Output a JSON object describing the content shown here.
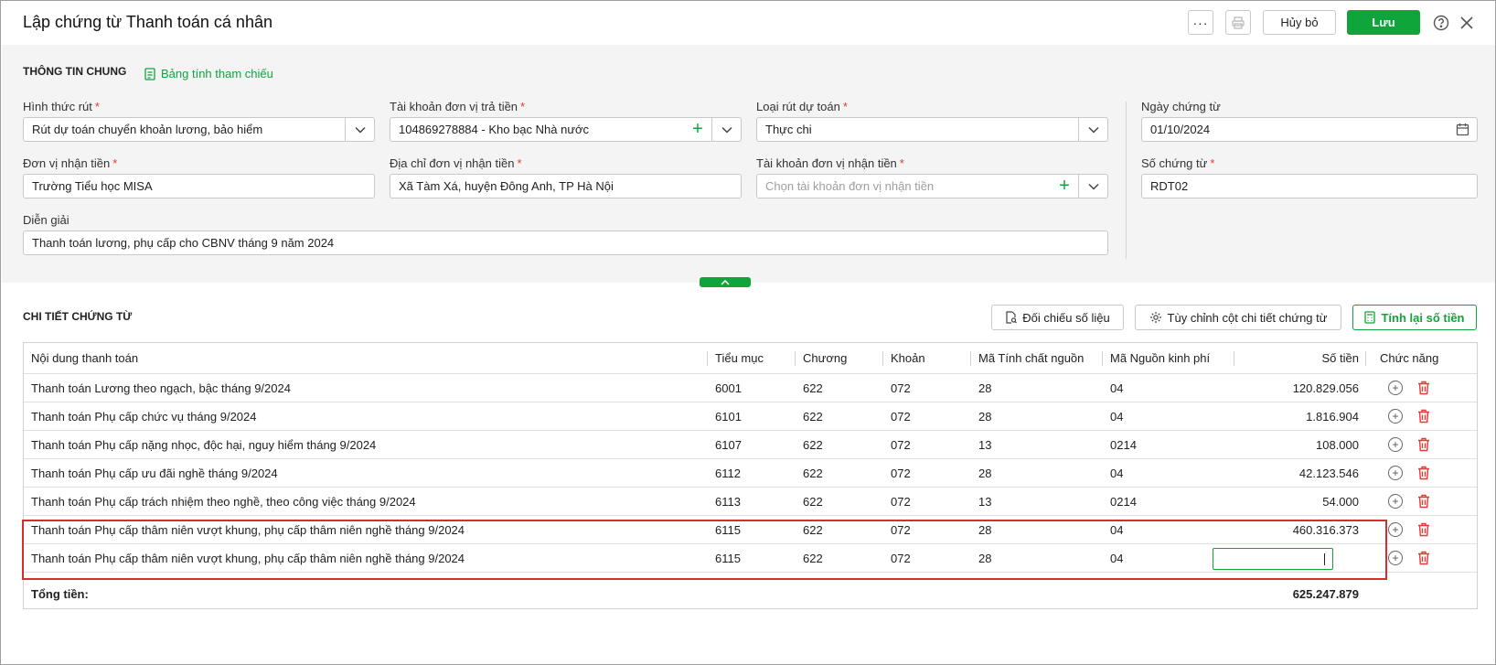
{
  "header": {
    "title": "Lập chứng từ Thanh toán cá nhân",
    "cancel_label": "Hủy bỏ",
    "save_label": "Lưu"
  },
  "general": {
    "section_title": "THÔNG TIN CHUNG",
    "reference_link": "Bảng tính tham chiếu",
    "fields": {
      "withdraw_type": {
        "label": "Hình thức rút",
        "value": "Rút dự toán chuyển khoản lương, bảo hiểm"
      },
      "payer_account": {
        "label": "Tài khoản đơn vị trả tiền",
        "value": "104869278884 - Kho bạc Nhà nước"
      },
      "estimate_type": {
        "label": "Loại rút dự toán",
        "value": "Thực chi"
      },
      "voucher_date": {
        "label": "Ngày chứng từ",
        "value": "01/10/2024"
      },
      "receiver": {
        "label": "Đơn vị nhận tiền",
        "value": "Trường Tiểu học MISA"
      },
      "receiver_address": {
        "label": "Địa chỉ đơn vị nhận tiền",
        "value": "Xã Tàm Xá, huyện Đông Anh, TP Hà Nội"
      },
      "receiver_account": {
        "label": "Tài khoản đơn vị nhận tiền",
        "placeholder": "Chọn tài khoản đơn vị nhận tiền"
      },
      "voucher_no": {
        "label": "Số chứng từ",
        "value": "RDT02"
      },
      "description": {
        "label": "Diễn giải",
        "value": "Thanh toán lương, phụ cấp cho CBNV tháng 9 năm 2024"
      }
    },
    "required_mark": "*"
  },
  "detail": {
    "section_title": "CHI TIẾT CHỨNG TỪ",
    "buttons": {
      "reconcile": "Đối chiếu số liệu",
      "customize": "Tùy chỉnh cột chi tiết chứng từ",
      "recalc": "Tính lại số tiền"
    },
    "columns": [
      "Nội dung thanh toán",
      "Tiểu mục",
      "Chương",
      "Khoản",
      "Mã Tính chất nguồn",
      "Mã Nguồn kinh phí",
      "Số tiền",
      "Chức năng"
    ],
    "rows": [
      {
        "content": "Thanh toán Lương theo ngạch, bậc tháng 9/2024",
        "sub": "6001",
        "chapter": "622",
        "item": "072",
        "src_nature": "28",
        "fund_src": "04",
        "amount": "120.829.056"
      },
      {
        "content": "Thanh toán Phụ cấp chức vụ tháng 9/2024",
        "sub": "6101",
        "chapter": "622",
        "item": "072",
        "src_nature": "28",
        "fund_src": "04",
        "amount": "1.816.904"
      },
      {
        "content": "Thanh toán Phụ cấp nặng nhọc, độc hại, nguy hiểm tháng 9/2024",
        "sub": "6107",
        "chapter": "622",
        "item": "072",
        "src_nature": "13",
        "fund_src": "0214",
        "amount": "108.000"
      },
      {
        "content": "Thanh toán Phụ cấp ưu đãi nghề tháng 9/2024",
        "sub": "6112",
        "chapter": "622",
        "item": "072",
        "src_nature": "28",
        "fund_src": "04",
        "amount": "42.123.546"
      },
      {
        "content": "Thanh toán Phụ cấp trách nhiệm theo nghề, theo công việc tháng 9/2024",
        "sub": "6113",
        "chapter": "622",
        "item": "072",
        "src_nature": "13",
        "fund_src": "0214",
        "amount": "54.000"
      },
      {
        "content": "Thanh toán Phụ cấp thâm niên vượt khung, phụ cấp thâm niên nghề tháng 9/2024",
        "sub": "6115",
        "chapter": "622",
        "item": "072",
        "src_nature": "28",
        "fund_src": "04",
        "amount": "460.316.373"
      },
      {
        "content": "Thanh toán Phụ cấp thâm niên vượt khung, phụ cấp thâm niên nghề tháng 9/2024",
        "sub": "6115",
        "chapter": "622",
        "item": "072",
        "src_nature": "28",
        "fund_src": "04",
        "amount": ""
      }
    ],
    "total_label": "Tổng tiền:",
    "total_amount": "625.247.879"
  },
  "colors": {
    "accent": "#10a53a",
    "danger": "#e53935",
    "highlight": "#d32f2f"
  }
}
